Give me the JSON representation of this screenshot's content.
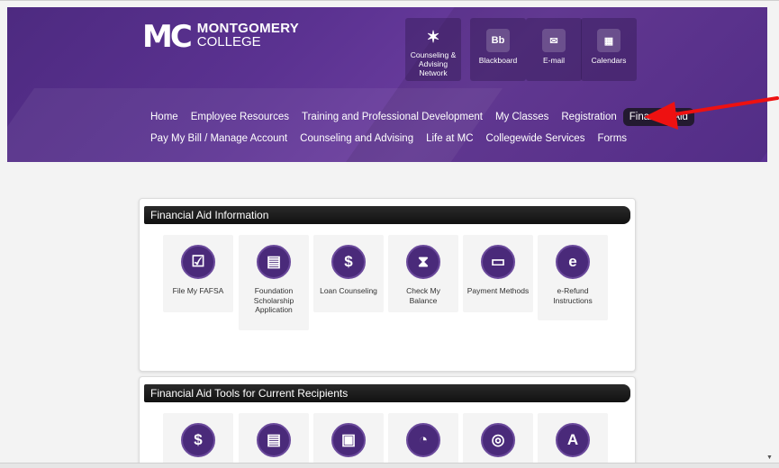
{
  "logo": {
    "mark": "MC",
    "line1": "MONTGOMERY",
    "line2": "COLLEGE"
  },
  "quick_links": [
    {
      "label": "Counseling & Advising Network",
      "icon": "star-icon",
      "glyph": "✶"
    },
    {
      "label": "Blackboard",
      "icon": "blackboard-icon",
      "glyph": "Bb"
    },
    {
      "label": "E-mail",
      "icon": "mail-icon",
      "glyph": "✉"
    },
    {
      "label": "Calendars",
      "icon": "calendar-icon",
      "glyph": "▦"
    }
  ],
  "nav_row1": [
    "Home",
    "Employee Resources",
    "Training and Professional Development",
    "My Classes",
    "Registration",
    "Financial Aid"
  ],
  "nav_row2": [
    "Pay My Bill / Manage Account",
    "Counseling and Advising",
    "Life at MC",
    "Collegewide Services",
    "Forms"
  ],
  "active_nav": "Financial Aid",
  "section1": {
    "title": "Financial Aid Information",
    "tiles": [
      {
        "label": "File My FAFSA",
        "icon": "fafsa-icon",
        "glyph": "☑"
      },
      {
        "label": "Foundation Scholarship Application",
        "icon": "document-icon",
        "glyph": "▤"
      },
      {
        "label": "Loan Counseling",
        "icon": "loan-counseling-icon",
        "glyph": "$"
      },
      {
        "label": "Check My Balance",
        "icon": "hourglass-icon",
        "glyph": "⧗"
      },
      {
        "label": "Payment Methods",
        "icon": "credit-card-icon",
        "glyph": "▭"
      },
      {
        "label": "e-Refund Instructions",
        "icon": "e-refund-icon",
        "glyph": "e"
      }
    ]
  },
  "section2": {
    "title": "Financial Aid Tools for Current Recipients",
    "tiles": [
      {
        "icon": "dollar-icon",
        "glyph": "$"
      },
      {
        "icon": "documents-icon",
        "glyph": "▤"
      },
      {
        "icon": "laptop-icon",
        "glyph": "▣"
      },
      {
        "icon": "chat-icon",
        "glyph": "◔"
      },
      {
        "icon": "search-badge-icon",
        "glyph": "◎"
      },
      {
        "icon": "document-a-icon",
        "glyph": "A"
      }
    ]
  },
  "colors": {
    "brand_purple": "#5b3291",
    "active_nav_bg": "#231a30",
    "tile_icon": "#4a2a7a",
    "annotation_arrow": "#ee1111"
  }
}
